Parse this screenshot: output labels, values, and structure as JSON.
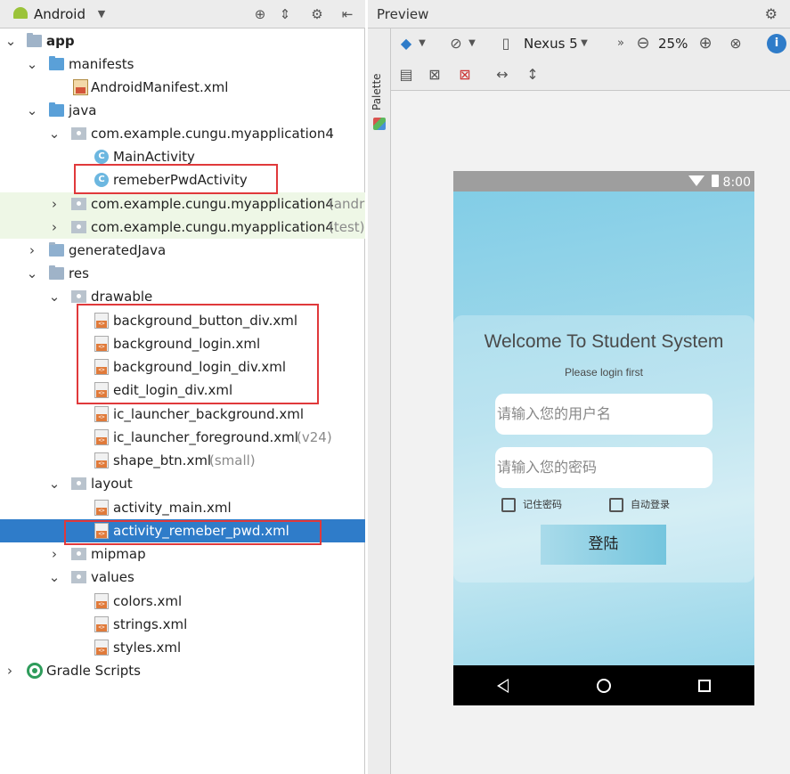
{
  "project_pane": {
    "view_selector": "Android",
    "tree": [
      {
        "label": "app"
      },
      {
        "label": "manifests"
      },
      {
        "label": "AndroidManifest.xml"
      },
      {
        "label": "java"
      },
      {
        "label": "com.example.cungu.myapplication4"
      },
      {
        "label": "MainActivity"
      },
      {
        "label": "remeberPwdActivity"
      },
      {
        "label": "com.example.cungu.myapplication4",
        "suffix": "(andr"
      },
      {
        "label": "com.example.cungu.myapplication4",
        "suffix": "(test)"
      },
      {
        "label": "generatedJava"
      },
      {
        "label": "res"
      },
      {
        "label": "drawable"
      },
      {
        "label": "background_button_div.xml"
      },
      {
        "label": "background_login.xml"
      },
      {
        "label": "background_login_div.xml"
      },
      {
        "label": "edit_login_div.xml"
      },
      {
        "label": "ic_launcher_background.xml"
      },
      {
        "label": "ic_launcher_foreground.xml",
        "suffix": "(v24)"
      },
      {
        "label": "shape_btn.xml",
        "suffix": "(small)"
      },
      {
        "label": "layout"
      },
      {
        "label": "activity_main.xml"
      },
      {
        "label": "activity_remeber_pwd.xml"
      },
      {
        "label": "mipmap"
      },
      {
        "label": "values"
      },
      {
        "label": "colors.xml"
      },
      {
        "label": "strings.xml"
      },
      {
        "label": "styles.xml"
      },
      {
        "label": "Gradle Scripts"
      }
    ],
    "selected_item": "activity_remeber_pwd.xml"
  },
  "preview_pane": {
    "title": "Preview",
    "palette_label": "Palette",
    "device": "Nexus 5",
    "zoom": "25%"
  },
  "phone": {
    "time": "8:00",
    "welcome": "Welcome To Student System",
    "subtitle": "Please login first",
    "username_placeholder": "请输入您的用户名",
    "password_placeholder": "请输入您的密码",
    "remember_label": "记住密码",
    "autologin_label": "自动登录",
    "login_button": "登陆"
  },
  "colors": {
    "selection": "#2f7cc9",
    "highlight_box": "#e0393b",
    "navbar": "#000000",
    "status_bar": "#9e9e9e"
  }
}
